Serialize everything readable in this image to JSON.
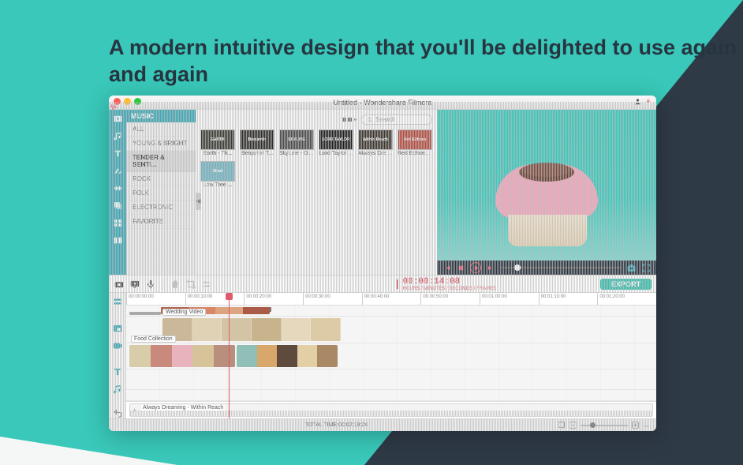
{
  "marketing_headline": "A modern intuitive design that you'll be delighted to use again and again",
  "window_title": "Untitled - Wondershare Filmora",
  "sidebar": {
    "header": "MUSIC",
    "items": [
      "ALL",
      "YOUNG & BRIGHT",
      "TENDER & SENTI...",
      "ROCK",
      "FOLK",
      "ELECTRONIC",
      "FAVORITE"
    ],
    "selected_index": 2
  },
  "library": {
    "search_placeholder": "Search",
    "thumbs": [
      {
        "label": "Earth - Th...",
        "caption": "EARTH",
        "bg": "#3b3a34"
      },
      {
        "label": "Benjamin T...",
        "caption": "Benjamin",
        "bg": "#2e2c2a"
      },
      {
        "label": "SkyLine - Ov...",
        "caption": "SKYLINE",
        "bg": "#4a4a4a"
      },
      {
        "label": "Lord Taylor ...",
        "caption": "LORD TAYLOR",
        "bg": "#1e1e1e"
      },
      {
        "label": "Always Drea...",
        "caption": "Within Reach",
        "bg": "#3a342c"
      },
      {
        "label": "Red Echoes ...",
        "caption": "Red Echoes",
        "bg": "#b94b3f"
      },
      {
        "label": "Low Tree ...",
        "caption": "Shaal",
        "bg": "#6fb5c4"
      }
    ]
  },
  "preview": {
    "timecode": "00:00:14:08",
    "timecode_units": "HOURS / MINUTES / SECONDS / FRAMES"
  },
  "toolbar": {
    "export_label": "EXPORT"
  },
  "ruler_ticks": [
    "00:00:00:00",
    "00:00:10:00",
    "00:00:20:00",
    "00:00:30:00",
    "00:00:40:00",
    "00:00:50:00",
    "00:01:00:00",
    "00:01:10:00",
    "00:01:20:00"
  ],
  "tracks": {
    "pip_label": "Wedding Video",
    "main_label": "Food Collection",
    "audio_label": "Always Dreaming - Within Reach"
  },
  "status": {
    "total_time_label": "TOTAL TIME:",
    "total_time_value": "00:02:19:24"
  }
}
